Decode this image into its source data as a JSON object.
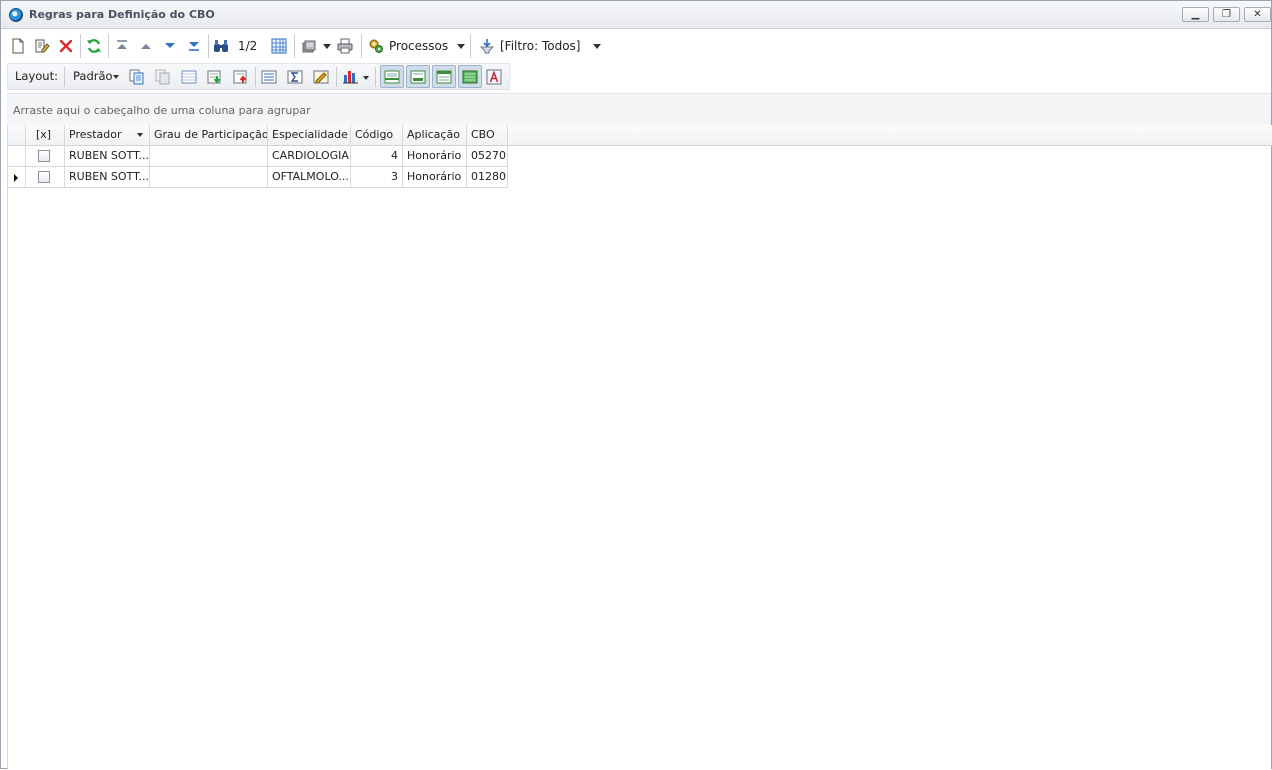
{
  "window": {
    "title": "Regras para Definição do CBO",
    "controls": {
      "minimize": "▁",
      "maximize": "❐",
      "close": "✕"
    }
  },
  "toolbar": {
    "record_counter": "1/2",
    "processes_label": "Processos",
    "filter_label": "[Filtro: Todos]"
  },
  "layout_bar": {
    "layout_label": "Layout:",
    "layout_value": "Padrão"
  },
  "group_panel": {
    "hint": "Arraste aqui o cabeçalho de uma coluna para agrupar"
  },
  "grid": {
    "columns": [
      "[x]",
      "Prestador",
      "Grau de Participação",
      "Especialidade",
      "Código",
      "Aplicação",
      "CBO"
    ],
    "rows": [
      {
        "checked": false,
        "prestador": "RUBEN SOTT...",
        "grau": "",
        "especialidade": "CARDIOLOGIA",
        "codigo": "4",
        "aplicacao": "Honorário",
        "cbo": "05270"
      },
      {
        "checked": false,
        "prestador": "RUBEN SOTT...",
        "grau": "",
        "especialidade": "OFTALMOLO...",
        "codigo": "3",
        "aplicacao": "Honorário",
        "cbo": "01280"
      }
    ]
  },
  "colors": {
    "accent": "#2f8fd8",
    "delete": "#d92b2b",
    "refresh": "#23a33b"
  }
}
